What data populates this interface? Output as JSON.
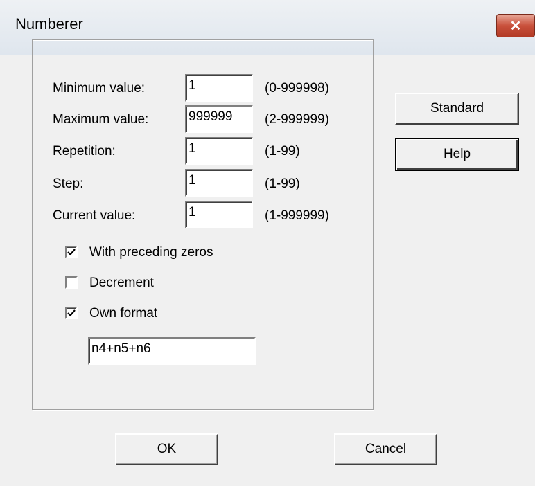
{
  "window": {
    "title": "Numberer",
    "close_label": "✕"
  },
  "fields": [
    {
      "label": "Minimum value:",
      "value": "1",
      "range": "(0-999998)"
    },
    {
      "label": "Maximum value:",
      "value": "999999",
      "range": "(2-999999)"
    },
    {
      "label": "Repetition:",
      "value": "1",
      "range": "(1-99)"
    },
    {
      "label": "Step:",
      "value": "1",
      "range": "(1-99)"
    },
    {
      "label": "Current value:",
      "value": "1",
      "range": "(1-999999)"
    }
  ],
  "options": [
    {
      "label": "With preceding zeros",
      "checked": true
    },
    {
      "label": "Decrement",
      "checked": false
    },
    {
      "label": "Own format",
      "checked": true
    }
  ],
  "format_value": "n4+n5+n6",
  "buttons": {
    "standard": "Standard",
    "help": "Help",
    "ok": "OK",
    "cancel": "Cancel"
  }
}
